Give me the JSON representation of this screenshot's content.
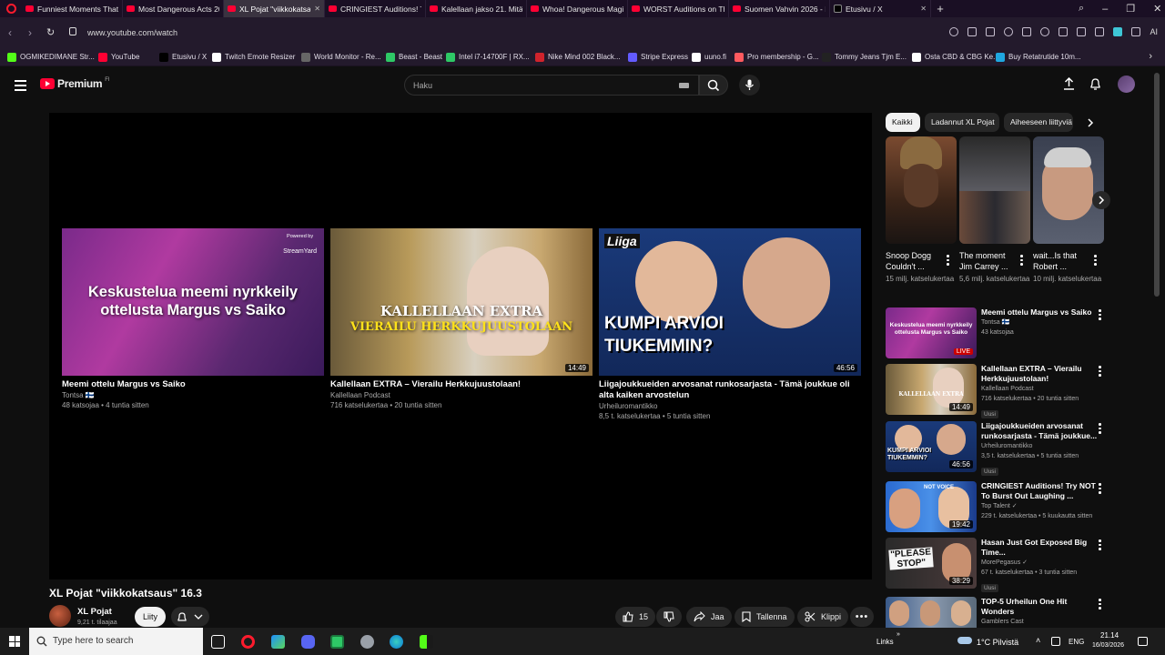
{
  "browser": {
    "tabs": [
      {
        "title": "Funniest Moments That M",
        "kind": "yt"
      },
      {
        "title": "Most Dangerous Acts 202",
        "kind": "yt"
      },
      {
        "title": "XL Pojat \"viikkokatsaus\" 1",
        "kind": "yt",
        "active": true
      },
      {
        "title": "CRINGIEST Auditions! Try I",
        "kind": "yt"
      },
      {
        "title": "Kalellaan jakso 21. Mitä m",
        "kind": "yt"
      },
      {
        "title": "Whoa! Dangerous Magic I",
        "kind": "yt"
      },
      {
        "title": "WORST Auditions on The",
        "kind": "yt"
      },
      {
        "title": "Suomen Vahvin 2026 - M",
        "kind": "yt"
      },
      {
        "title": "Etusivu / X",
        "kind": "x"
      }
    ],
    "url": "www.youtube.com/watch",
    "toolbar_ai": "AI",
    "bookmarks": [
      {
        "label": "OGMIKEDIMANE Str...",
        "color": "#53fc18",
        "w": 100
      },
      {
        "label": "YouTube",
        "color": "#ff0033",
        "w": 67
      },
      {
        "label": "Etusivu / X",
        "color": "#000000",
        "w": 58
      },
      {
        "label": "Twitch Emote Resizer",
        "color": "#ffffff",
        "w": 98
      },
      {
        "label": "World Monitor - Re...",
        "color": "#666666",
        "w": 93
      },
      {
        "label": "Beast - Beast",
        "color": "#2ec866",
        "w": 66
      },
      {
        "label": "Intel i7-14700F | RX...",
        "color": "#2ec866",
        "w": 98
      },
      {
        "label": "Nike Mind 002 Black...",
        "color": "#d0232c",
        "w": 102
      },
      {
        "label": "Stripe Express",
        "color": "#635bff",
        "w": 70
      },
      {
        "label": "uuno.fi",
        "color": "#ffffff",
        "w": 47
      },
      {
        "label": "Pro membership - G...",
        "color": "#ff5a5f",
        "w": 96
      },
      {
        "label": "Tommy Jeans Tjm E...",
        "color": "#222222",
        "w": 99
      },
      {
        "label": "Osta CBD & CBG Ke...",
        "color": "#ffffff",
        "w": 92
      },
      {
        "label": "Buy Retatrutide 10m...",
        "color": "#1fa7e0",
        "w": 100
      }
    ]
  },
  "youtube": {
    "logo_word": "Premium",
    "logo_region": "FI",
    "search_placeholder": "Haku",
    "player": {
      "endscreen": [
        {
          "title": "Meemi ottelu Margus vs Saiko",
          "channel": "Tontsa 🇫🇮",
          "meta": "48 katsojaa • 4 tuntia sitten",
          "thumb_text": "Keskustelua meemi nyrkkeily ottelusta Margus vs Saiko",
          "badge_top": "Powered by",
          "badge_brand": "StreamYard",
          "duration": ""
        },
        {
          "title": "Kallellaan EXTRA – Vierailu Herkkujuustolaan!",
          "channel": "Kallellaan Podcast",
          "meta": "716 katselukertaa • 20 tuntia sitten",
          "thumb_text": "KALLELLAAN EXTRA",
          "thumb_sub": "VIERAILU HERKKUJUUSTOLAAN",
          "duration": "14:49"
        },
        {
          "title": "Liigajoukkueiden arvosanat runkosarjasta - Tämä joukkue oli alta kaiken arvostelun",
          "channel": "Urheiluromantikko",
          "meta": "8,5 t. katselukertaa • 5 tuntia sitten",
          "thumb_text": "KUMPI ARVIOI TIUKEMMIN?",
          "thumb_logo": "Liiga",
          "duration": "46:56"
        }
      ]
    },
    "video": {
      "title": "XL Pojat \"viikkokatsaus\" 16.3",
      "channel": "XL Pojat",
      "subs": "9,21 t. tilaajaa",
      "join": "Liity",
      "likes": "15",
      "share": "Jaa",
      "save": "Tallenna",
      "clip": "Klippi"
    },
    "chips": [
      "Kaikki",
      "Ladannut XL Pojat",
      "Aiheeseen liittyviä"
    ],
    "shorts": [
      {
        "title": "Snoop Dogg Couldn't ...",
        "views": "15 milj. katselukertaa"
      },
      {
        "title": "The moment Jim Carrey ...",
        "views": "5,6 milj. katselukertaa"
      },
      {
        "title": "wait...Is that Robert ...",
        "views": "10 milj. katselukertaa"
      }
    ],
    "recommendations": [
      {
        "title": "Meemi ottelu Margus vs Saiko",
        "channel": "Tontsa 🇫🇮",
        "meta": "43 katsojaa",
        "badge": "",
        "duration": "LIVE",
        "thumb_text": "Keskustelua meemi nyrkkeily ottelusta Margus vs Saiko"
      },
      {
        "title": "Kallellaan EXTRA – Vierailu Herkkujuustolaan!",
        "channel": "Kallellaan Podcast",
        "meta": "716 katselukertaa • 20 tuntia sitten",
        "badge": "Uusi",
        "duration": "14:49",
        "thumb_text": "KALLELLAAN EXTRA"
      },
      {
        "title": "Liigajoukkueiden arvosanat runkosarjasta - Tämä joukkue...",
        "channel": "Urheiluromantikko",
        "meta": "3,5 t. katselukertaa • 5 tuntia sitten",
        "badge": "Uusi",
        "duration": "46:56",
        "thumb_text": "KUMPI ARVIOI TIUKEMMIN?"
      },
      {
        "title": "CRINGIEST Auditions! Try NOT To Burst Out Laughing ...",
        "channel": "Top Talent ✓",
        "meta": "229 t. katselukertaa • 5 kuukautta sitten",
        "badge": "",
        "duration": "19:42",
        "thumb_text": "NOT VOICE"
      },
      {
        "title": "Hasan Just Got Exposed Big Time...",
        "channel": "MorePegasus ✓",
        "meta": "67 t. katselukertaa • 3 tuntia sitten",
        "badge": "Uusi",
        "duration": "38:29",
        "thumb_text": "\"PLEASE STOP\""
      },
      {
        "title": "TOP-5 Urheilun One Hit Wonders",
        "channel": "Gamblers Cast",
        "meta": "",
        "badge": "",
        "duration": "",
        "thumb_text": ""
      }
    ]
  },
  "taskbar": {
    "search_placeholder": "Type here to search",
    "links": "Links",
    "weather": "1°C  Pilvistä",
    "lang": "ENG",
    "time": "21.14",
    "date": "16/03/2026"
  },
  "colors": {
    "yt_red": "#ff0033",
    "bg": "#0f0f0f",
    "opera_red": "#ff1b2d"
  }
}
